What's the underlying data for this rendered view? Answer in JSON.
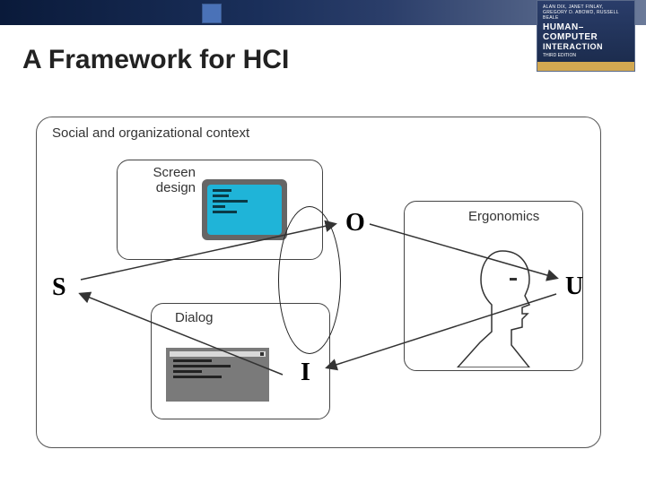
{
  "header": {
    "book": {
      "authors_line1": "ALAN DIX, JANET FINLAY,",
      "authors_line2": "GREGORY D. ABOWD, RUSSELL BEALE",
      "title_line1": "HUMAN–COMPUTER",
      "title_line2": "INTERACTION",
      "edition": "THIRD EDITION"
    }
  },
  "slide": {
    "title": "A Framework for HCI"
  },
  "diagram": {
    "outer_label": "Social and organizational context",
    "boxes": {
      "screen_design": "Screen design",
      "ergonomics": "Ergonomics",
      "dialog": "Dialog"
    },
    "markers": {
      "S": "S",
      "O": "O",
      "I": "I",
      "U": "U"
    }
  }
}
